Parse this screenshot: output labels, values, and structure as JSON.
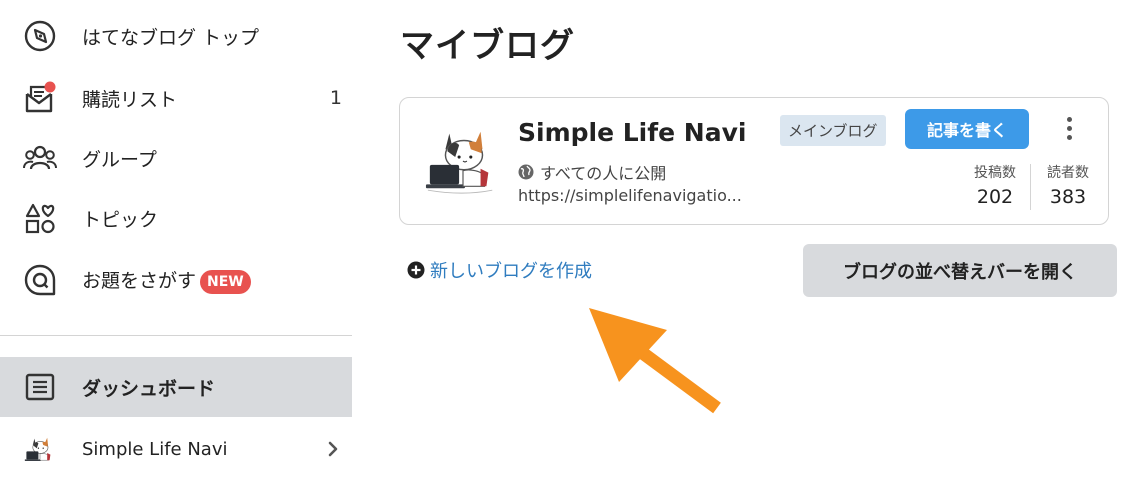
{
  "sidebar": {
    "items": [
      {
        "label": "はてなブログ トップ",
        "icon": "compass-icon"
      },
      {
        "label": "購読リスト",
        "icon": "mail-notification-icon",
        "count": "1"
      },
      {
        "label": "グループ",
        "icon": "group-icon"
      },
      {
        "label": "トピック",
        "icon": "topic-shapes-icon"
      },
      {
        "label": "お題をさがす",
        "icon": "search-q-icon",
        "badge": "NEW"
      }
    ],
    "dashboard": {
      "label": "ダッシュボード",
      "icon": "dashboard-icon"
    },
    "blog_entry": {
      "label": "Simple Life Navi",
      "icon": "chevron-right-icon"
    }
  },
  "main": {
    "title": "マイブログ",
    "blog_card": {
      "name": "Simple Life Navi",
      "visibility": "すべての人に公開",
      "url": "https://simplelifenavigatio...",
      "badge": "メインブログ",
      "write_button": "記事を書く",
      "stats": [
        {
          "label": "投稿数",
          "value": "202"
        },
        {
          "label": "読者数",
          "value": "383"
        }
      ]
    },
    "new_blog_link": "新しいブログを作成",
    "reorder_button": "ブログの並べ替えバーを開く"
  },
  "colors": {
    "accent_blue": "#3d9ae8",
    "link_blue": "#2f7cbf",
    "new_badge": "#e8524f",
    "annotation_arrow": "#f7931e",
    "active_bg": "#d8dadd"
  }
}
